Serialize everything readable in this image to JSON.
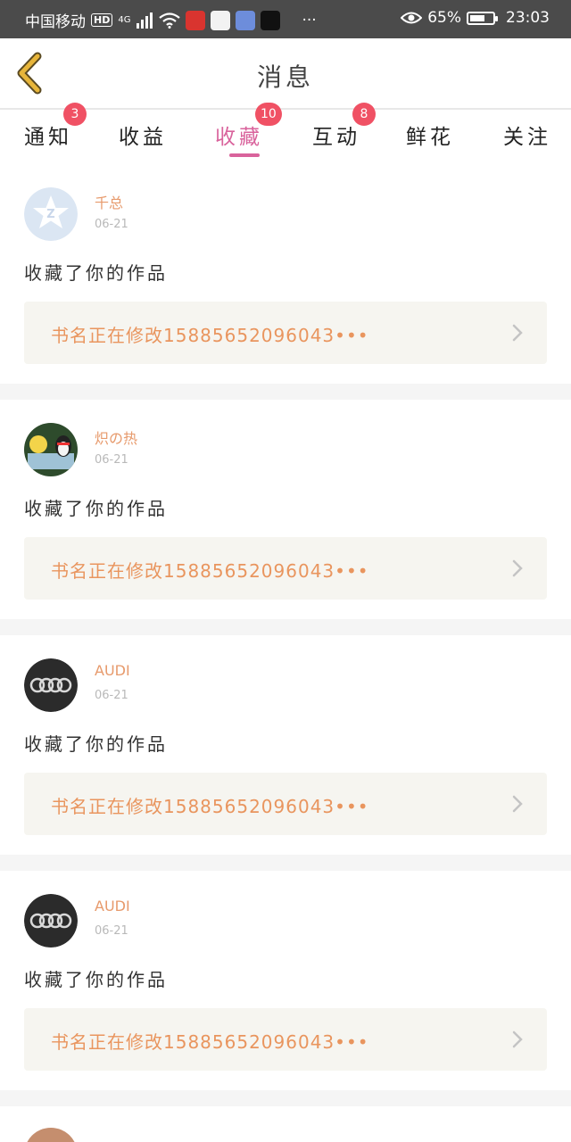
{
  "status_bar": {
    "carrier": "中国移动",
    "hd": "HD",
    "network": "4G",
    "battery": "65%",
    "battery_level": 0.65,
    "time": "23:03",
    "more": "···"
  },
  "header": {
    "title": "消息",
    "back_icon": "chevron-left-icon"
  },
  "tabs": [
    {
      "label": "通知",
      "badge": "3"
    },
    {
      "label": "收益",
      "badge": ""
    },
    {
      "label": "收藏",
      "badge": "10",
      "active": true
    },
    {
      "label": "互动",
      "badge": "8"
    },
    {
      "label": "鲜花",
      "badge": ""
    },
    {
      "label": "关注",
      "badge": ""
    }
  ],
  "feed": [
    {
      "user": "千总",
      "date": "06-21",
      "message": "收藏了你的作品",
      "work": "书名正在修改15885652096043•••"
    },
    {
      "user": "炽の热",
      "date": "06-21",
      "message": "收藏了你的作品",
      "work": "书名正在修改15885652096043•••"
    },
    {
      "user": "AUDI",
      "date": "06-21",
      "message": "收藏了你的作品",
      "work": "书名正在修改15885652096043•••"
    },
    {
      "user": "AUDI",
      "date": "06-21",
      "message": "收藏了你的作品",
      "work": "书名正在修改15885652096043•••"
    }
  ],
  "colors": {
    "accent": "#d9639c",
    "badge": "#f05164",
    "username": "#e79a6c",
    "work_link": "#e9955e",
    "back_arrow": "#e7b53a"
  }
}
